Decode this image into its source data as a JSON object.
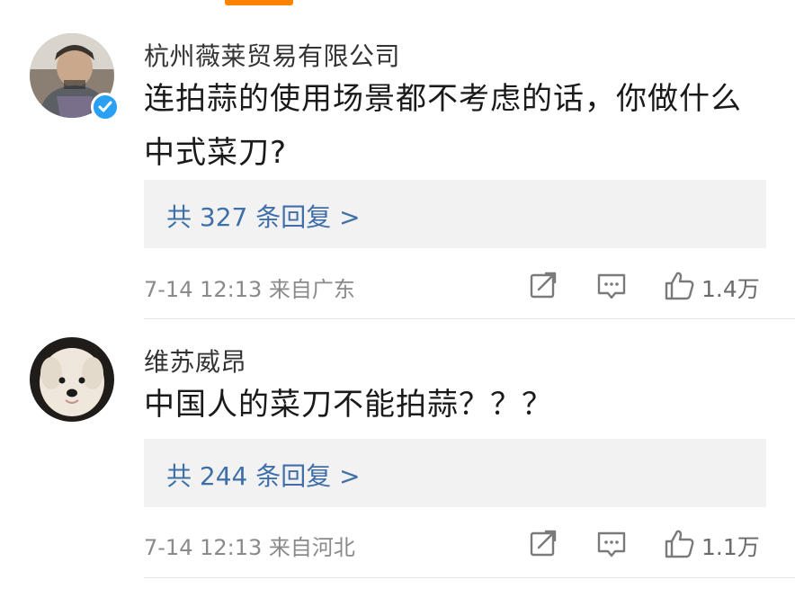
{
  "colors": {
    "accent": "#ff8200",
    "link": "#3f6fa8",
    "verified": "#2aa0f4"
  },
  "comments": [
    {
      "username": "杭州薇莱贸易有限公司",
      "verified": true,
      "text": "连拍蒜的使用场景都不考虑的话，你做什么中式菜刀?",
      "replies": "共 327 条回复 >",
      "time": "7-14 12:13",
      "location": "来自广东",
      "likes": "1.4万",
      "icons": [
        "share-icon",
        "comment-icon",
        "like-icon"
      ]
    },
    {
      "username": "维苏威昂",
      "verified": false,
      "text": "中国人的菜刀不能拍蒜？？？",
      "replies": "共 244 条回复 >",
      "time": "7-14 12:13",
      "location": "来自河北",
      "likes": "1.1万",
      "icons": [
        "share-icon",
        "comment-icon",
        "like-icon"
      ]
    }
  ]
}
